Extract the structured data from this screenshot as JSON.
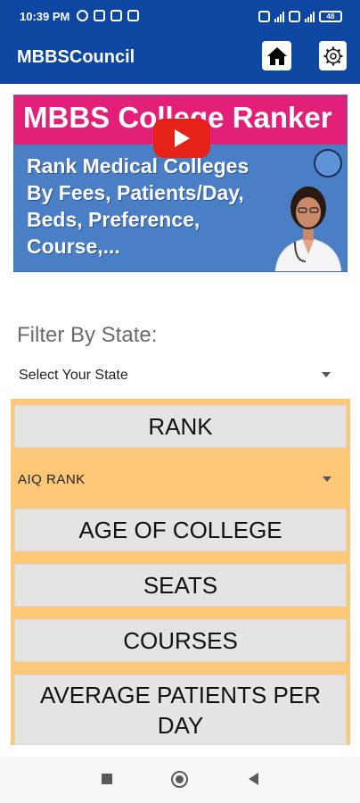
{
  "status_bar": {
    "time": "10:39 PM",
    "battery": "48"
  },
  "app_bar": {
    "title": "MBBSCouncil",
    "icons": [
      "home-icon",
      "gear-icon"
    ]
  },
  "banner": {
    "title": "MBBS College Ranker",
    "lines": [
      "Rank Medical Colleges",
      "By Fees, Patients/Day,",
      "Beds, Preference,",
      "Course,..."
    ],
    "icon": "youtube-play-icon"
  },
  "filter": {
    "label": "Filter By State:",
    "state_value": "Select Your State"
  },
  "options": {
    "rank_label": "RANK",
    "rank_type_value": "AIQ RANK",
    "age_label": "AGE OF COLLEGE",
    "seats_label": "SEATS",
    "courses_label": "COURSES",
    "patients_label": "AVERAGE PATIENTS PER DAY"
  },
  "colors": {
    "app_bar": "#0d47a1",
    "panel": "#fcc877",
    "option_button": "#e4e4e4",
    "banner_pink": "#e2207a",
    "banner_blue": "#4a7fc6"
  }
}
